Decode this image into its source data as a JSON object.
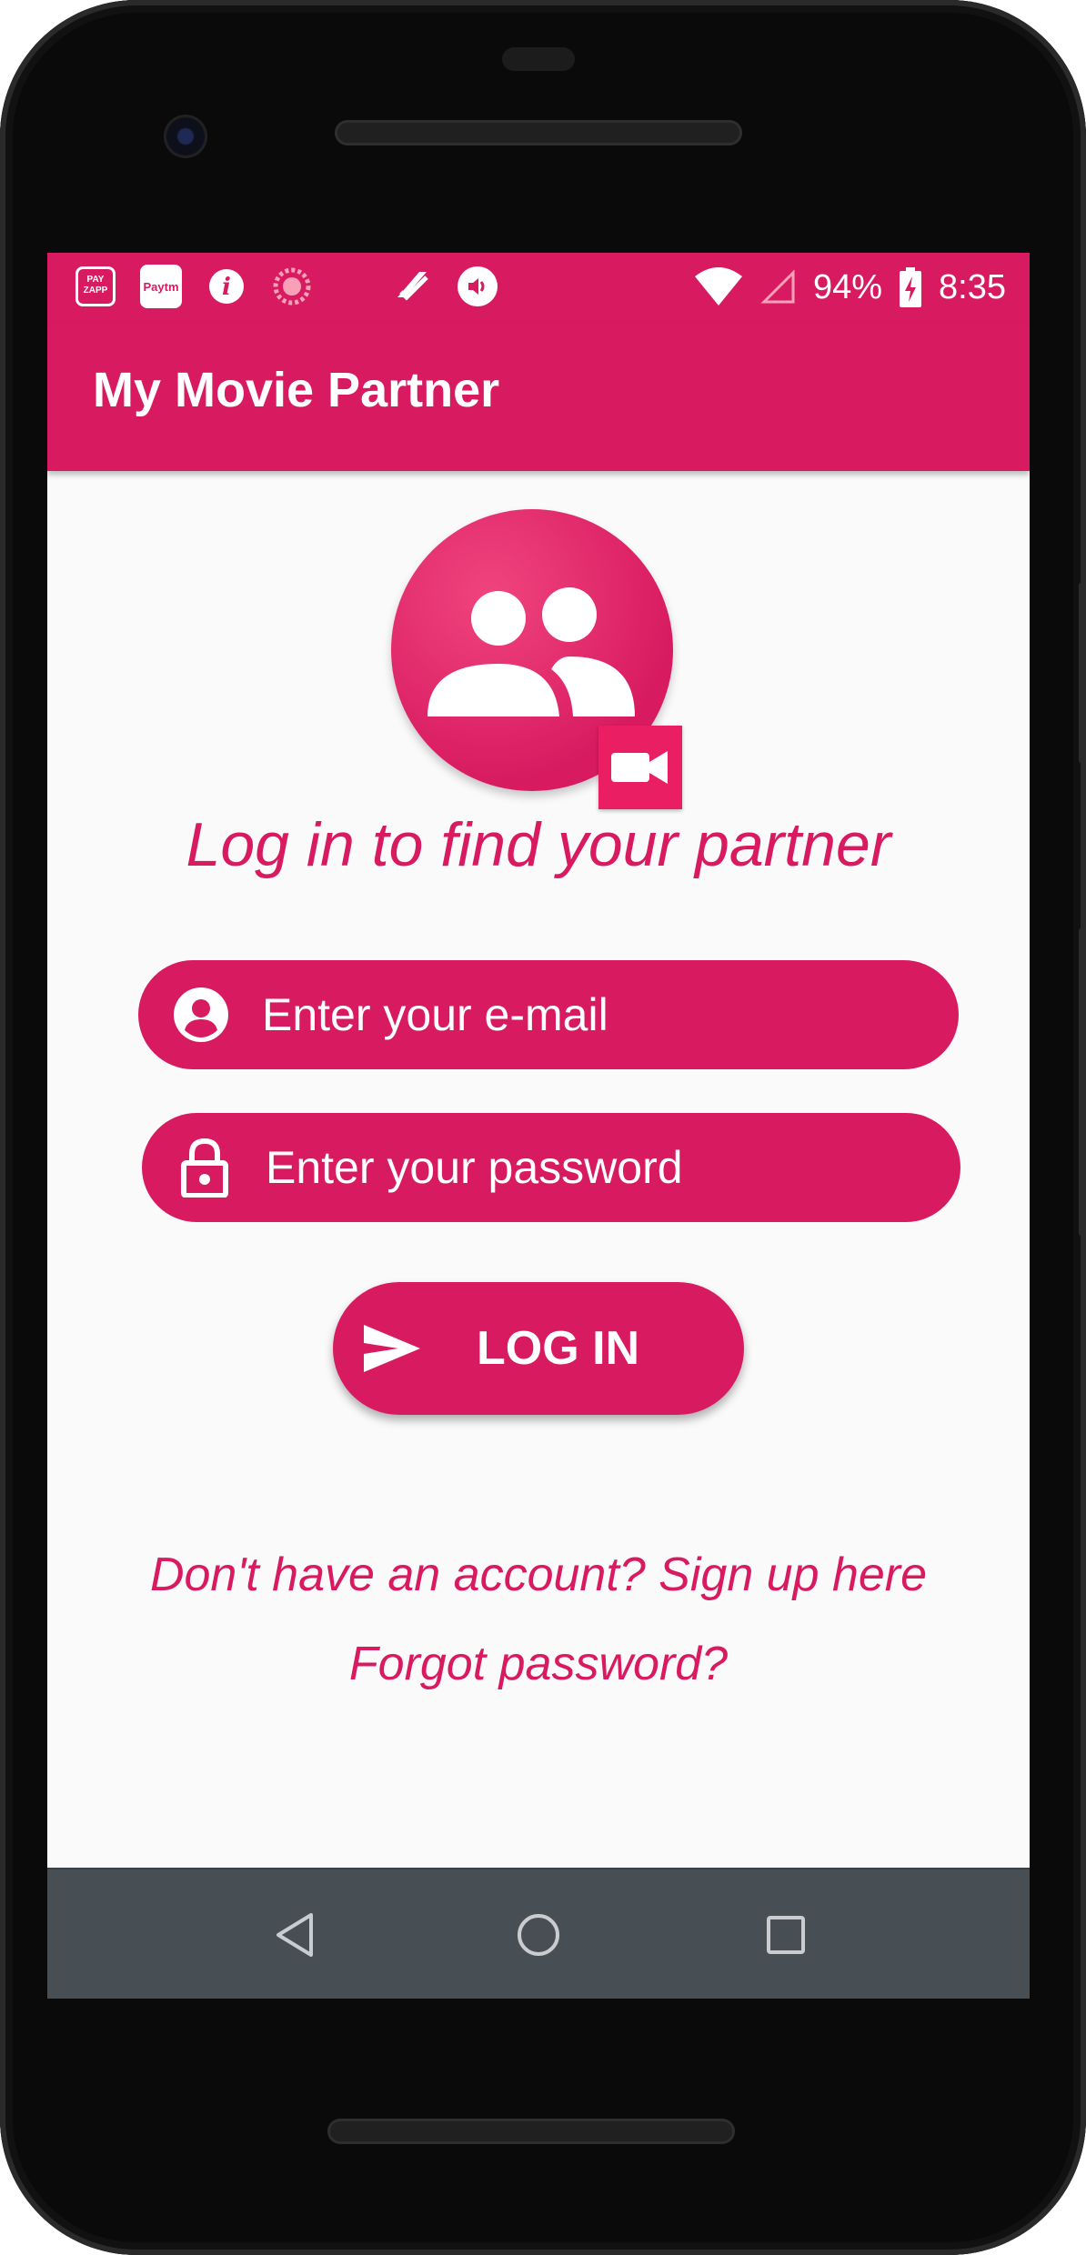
{
  "status_bar": {
    "app_icons": [
      "payzapp-icon",
      "paytm-icon",
      "info-app-icon",
      "sync-icon",
      "task-icon",
      "volume-icon"
    ],
    "paytm_label": "Paytm",
    "payzapp_label": "PAY ZAPP",
    "battery": "94%",
    "time": "8:35"
  },
  "app_bar": {
    "title": "My Movie Partner"
  },
  "main": {
    "headline": "Log in to find your partner",
    "email_placeholder": "Enter your e-mail",
    "password_placeholder": "Enter your password",
    "login_label": "LOG IN",
    "signup_link": "Don't have an account? Sign up here",
    "forgot_link": "Forgot password?"
  },
  "colors": {
    "primary": "#d81b60",
    "background": "#fafafa",
    "navbar": "#474f55"
  }
}
